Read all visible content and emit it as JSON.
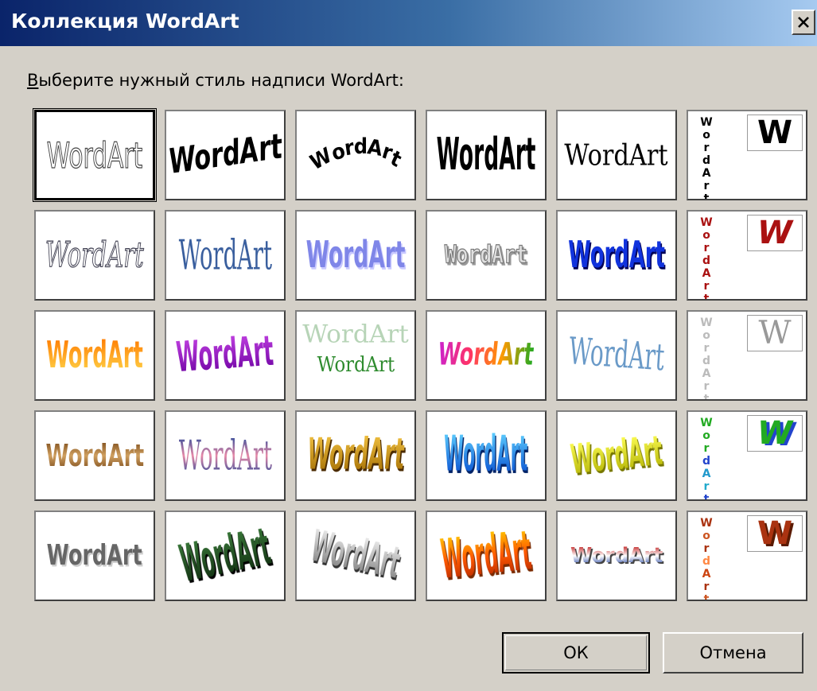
{
  "window": {
    "title": "Коллекция WordArt"
  },
  "prompt": {
    "first_letter": "В",
    "rest": "ыберите нужный стиль надписи WordArt:"
  },
  "sample_text": "WordArt",
  "vertical_letters": [
    "W",
    "o",
    "r",
    "d",
    "A",
    "r",
    "t"
  ],
  "w_letter": "W",
  "buttons": {
    "ok": "ОК",
    "cancel": "Отмена"
  },
  "gallery": {
    "rows": 5,
    "columns": 6,
    "selected_index": 0,
    "styles": [
      {
        "style": "outline-gray",
        "colors": [
          "#ffffff",
          "#555555"
        ]
      },
      {
        "style": "arch-up-black",
        "colors": [
          "#000000"
        ]
      },
      {
        "style": "arch-black",
        "colors": [
          "#000000"
        ]
      },
      {
        "style": "tall-black",
        "colors": [
          "#000000"
        ]
      },
      {
        "style": "serif-slant-black",
        "colors": [
          "#000000"
        ]
      },
      {
        "style": "vertical-black",
        "colors": [
          "#000000"
        ]
      },
      {
        "style": "italic-outline-gray",
        "colors": [
          "#ffffff",
          "#555577"
        ]
      },
      {
        "style": "serif-blue",
        "colors": [
          "#3a5f9e"
        ]
      },
      {
        "style": "bold-lavender",
        "colors": [
          "#7f86e8"
        ]
      },
      {
        "style": "silver-outline",
        "colors": [
          "#c8c8c8",
          "#707070"
        ]
      },
      {
        "style": "blue-navy",
        "colors": [
          "#1133dd",
          "#000055"
        ]
      },
      {
        "style": "vertical-red",
        "colors": [
          "#aa1111"
        ]
      },
      {
        "style": "orange-gradient",
        "colors": [
          "#ff8800",
          "#ffd54a"
        ]
      },
      {
        "style": "purple-arch",
        "colors": [
          "#9a20c0"
        ]
      },
      {
        "style": "green-reflection",
        "colors": [
          "#2e8b2e",
          "#b7d4b7"
        ]
      },
      {
        "style": "rainbow-perspective",
        "colors": [
          "#cc22cc",
          "#ff9900",
          "#22aa22"
        ]
      },
      {
        "style": "light-blue-serif",
        "colors": [
          "#5f8fbf"
        ]
      },
      {
        "style": "vertical-silver",
        "colors": [
          "#bbbbbb"
        ]
      },
      {
        "style": "brown-wood",
        "colors": [
          "#7a4a1a",
          "#c79a5a"
        ]
      },
      {
        "style": "pink-blue-serif",
        "colors": [
          "#d86a8a",
          "#2a4a9a"
        ]
      },
      {
        "style": "gold-3d",
        "colors": [
          "#c78a10",
          "#5a3a00"
        ]
      },
      {
        "style": "cyan-blue-wave",
        "colors": [
          "#2aa8ff",
          "#0033aa"
        ]
      },
      {
        "style": "yellow-wave",
        "colors": [
          "#f0ee22",
          "#8a8a00"
        ]
      },
      {
        "style": "vertical-green-blue",
        "colors": [
          "#22aa22",
          "#2244cc"
        ]
      },
      {
        "style": "gray-shadow",
        "colors": [
          "#666666",
          "#dddddd"
        ]
      },
      {
        "style": "dark-green-3d",
        "colors": [
          "#1e4a1e"
        ]
      },
      {
        "style": "silver-3d-slant",
        "colors": [
          "#9a9a9a",
          "#444444"
        ]
      },
      {
        "style": "orange-fire-3d",
        "colors": [
          "#ff6a00",
          "#ffcc00"
        ]
      },
      {
        "style": "red-white-blue",
        "colors": [
          "#c02020",
          "#2040a0"
        ]
      },
      {
        "style": "vertical-brown-red",
        "colors": [
          "#aa3311",
          "#ff8844"
        ]
      }
    ]
  }
}
